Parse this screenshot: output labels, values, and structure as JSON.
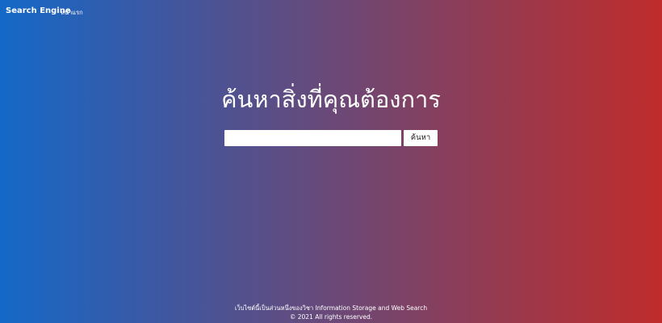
{
  "navbar": {
    "brand": "Search Engine",
    "links": [
      {
        "label": "หน้าแรก"
      }
    ]
  },
  "hero": {
    "title": "ค้นหาสิ่งที่คุณต้องการ"
  },
  "search": {
    "value": "",
    "placeholder": "",
    "button_label": "ค้นหา"
  },
  "footer": {
    "line1": "เว็บไซต์นี้เป็นส่วนหนึ่งของวิชา Information Storage and Web Search",
    "line2": "© 2021 All rights reserved."
  },
  "colors": {
    "gradient_start": "#1469c8",
    "gradient_end": "#bf2c2b",
    "text": "#ffffff",
    "input_bg": "#ffffff"
  }
}
